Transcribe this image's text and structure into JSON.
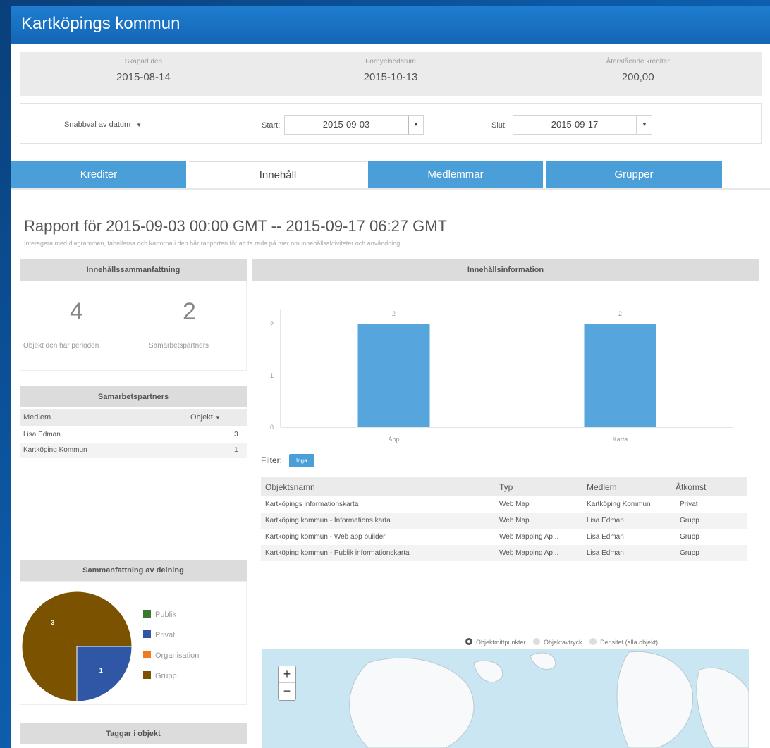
{
  "app": {
    "title": "Kartköpings kommun"
  },
  "stats": [
    {
      "label": "Skapad den",
      "value": "2015-08-14"
    },
    {
      "label": "Förnyelsedatum",
      "value": "2015-10-13"
    },
    {
      "label": "Återstående krediter",
      "value": "200,00"
    }
  ],
  "datebar": {
    "quick_label": "Snabbval av datum",
    "start_label": "Start:",
    "start_value": "2015-09-03",
    "end_label": "Slut:",
    "end_value": "2015-09-17"
  },
  "tabs": [
    {
      "label": "Krediter",
      "active": false
    },
    {
      "label": "Innehåll",
      "active": true
    },
    {
      "label": "Medlemmar",
      "active": false
    },
    {
      "label": "Grupper",
      "active": false
    }
  ],
  "report": {
    "title": "Rapport för 2015-09-03 00:00 GMT -- 2015-09-17 06:27 GMT",
    "subtitle": "Interagera med diagrammen, tabellerna och kartorna i den här rapporten för att ta reda på mer om innehållsaktiviteter och användning"
  },
  "content_summary": {
    "header": "Innehållssammanfattning",
    "objects_count": "4",
    "objects_label": "Objekt den här perioden",
    "partners_count": "2",
    "partners_label": "Samarbetspartners"
  },
  "partners": {
    "header": "Samarbetspartners",
    "col_member": "Medlem",
    "col_objects": "Objekt",
    "rows": [
      {
        "member": "Lisa Edman",
        "objects": "3"
      },
      {
        "member": "Kartköping Kommun",
        "objects": "1"
      }
    ]
  },
  "sharing": {
    "header": "Sammanfattning av delning",
    "legend": [
      {
        "label": "Publik",
        "color": "#3a7a2e"
      },
      {
        "label": "Privat",
        "color": "#3056a6"
      },
      {
        "label": "Organisation",
        "color": "#f07b1e"
      },
      {
        "label": "Grupp",
        "color": "#7a5200"
      }
    ]
  },
  "tags": {
    "header": "Taggar i objekt"
  },
  "content_info": {
    "header": "Innehållsinformation"
  },
  "chart_data": [
    {
      "type": "bar",
      "categories": [
        "App",
        "Karta"
      ],
      "values": [
        2,
        2
      ],
      "data_labels": [
        "2",
        "2"
      ],
      "yticks": [
        "0",
        "1",
        "2"
      ],
      "ylim": [
        0,
        2.3
      ],
      "color": "#56a5dc",
      "grid": false
    },
    {
      "type": "pie",
      "categories": [
        "Grupp",
        "Privat"
      ],
      "values": [
        3,
        1
      ],
      "data_labels": [
        "3",
        "1"
      ],
      "colors": [
        "#7a5200",
        "#3056a6"
      ]
    }
  ],
  "filter": {
    "label": "Filter:",
    "value": "Inga"
  },
  "objects_table": {
    "columns": [
      "Objektsnamn",
      "Typ",
      "Medlem",
      "Åtkomst"
    ],
    "rows": [
      [
        "Kartköpings informationskarta",
        "Web Map",
        "Kartköping Kommun",
        "Privat"
      ],
      [
        "Kartköping kommun - Informations karta",
        "Web Map",
        "Lisa Edman",
        "Grupp"
      ],
      [
        "Kartköping kommun - Web app builder",
        "Web Mapping Ap...",
        "Lisa Edman",
        "Grupp"
      ],
      [
        "Kartköping kommun - Publik informationskarta",
        "Web Mapping Ap...",
        "Lisa Edman",
        "Grupp"
      ]
    ]
  },
  "map_options": {
    "options": [
      "Objektmittpunkter",
      "Objektavtryck",
      "Densitet (alla objekt)"
    ],
    "selected": "Objektmittpunkter"
  },
  "map": {
    "zoom_in": "+",
    "zoom_out": "−"
  }
}
